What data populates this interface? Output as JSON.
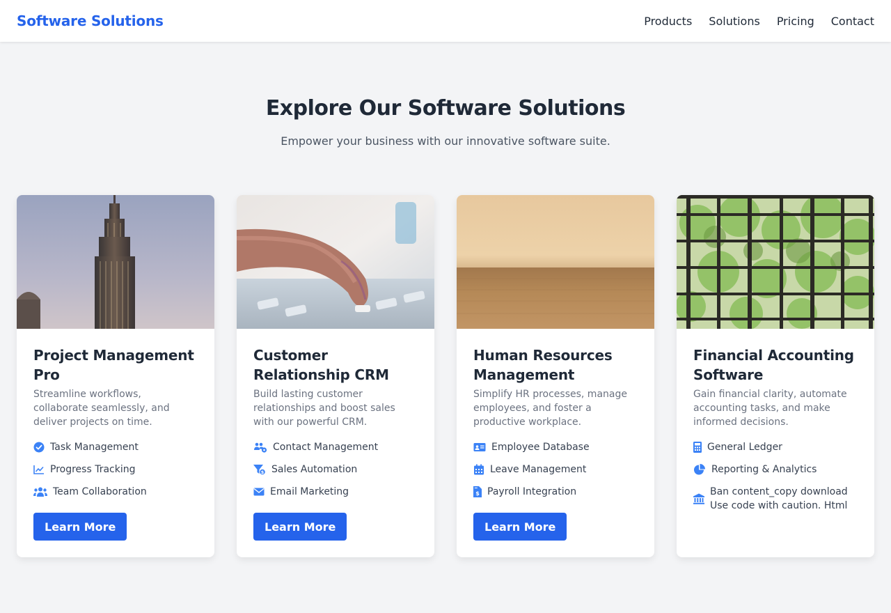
{
  "header": {
    "brand": "Software Solutions",
    "nav": [
      "Products",
      "Solutions",
      "Pricing",
      "Contact"
    ]
  },
  "hero": {
    "title": "Explore Our Software Solutions",
    "subtitle": "Empower your business with our innovative software suite."
  },
  "colors": {
    "accent": "#2563eb",
    "background": "#f3f4f6",
    "text": "#1f2937",
    "muted": "#6b7280"
  },
  "cards": [
    {
      "image": "skyscraper-photo",
      "title": "Project Management Pro",
      "description": "Streamline workflows, collaborate seamlessly, and deliver projects on time.",
      "features": [
        {
          "icon": "check-circle-icon",
          "label": "Task Management"
        },
        {
          "icon": "chart-line-icon",
          "label": "Progress Tracking"
        },
        {
          "icon": "users-icon",
          "label": "Team Collaboration"
        }
      ],
      "button": "Learn More"
    },
    {
      "image": "hand-typing-photo",
      "title": "Customer Relationship CRM",
      "description": "Build lasting customer relationships and boost sales with our powerful CRM.",
      "features": [
        {
          "icon": "users-gear-icon",
          "label": "Contact Management"
        },
        {
          "icon": "funnel-dollar-icon",
          "label": "Sales Automation"
        },
        {
          "icon": "envelope-icon",
          "label": "Email Marketing"
        }
      ],
      "button": "Learn More"
    },
    {
      "image": "wheat-field-photo",
      "title": "Human Resources Management",
      "description": "Simplify HR processes, manage employees, and foster a productive workplace.",
      "features": [
        {
          "icon": "id-card-icon",
          "label": "Employee Database"
        },
        {
          "icon": "calendar-icon",
          "label": "Leave Management"
        },
        {
          "icon": "file-invoice-dollar-icon",
          "label": "Payroll Integration"
        }
      ],
      "button": "Learn More"
    },
    {
      "image": "window-trees-photo",
      "title": "Financial Accounting Software",
      "description": "Gain financial clarity, automate accounting tasks, and make informed decisions.",
      "features": [
        {
          "icon": "calculator-icon",
          "label": "General Ledger"
        },
        {
          "icon": "pie-chart-icon",
          "label": "Reporting & Analytics"
        },
        {
          "icon": "bank-icon",
          "label": "Ban content_copy download Use code with caution. Html"
        }
      ],
      "button": ""
    }
  ]
}
